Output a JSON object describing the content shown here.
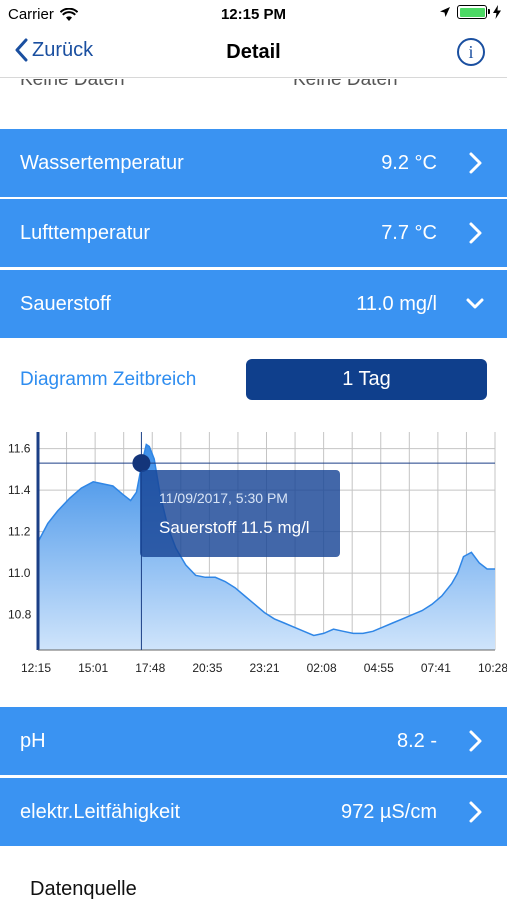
{
  "status_bar": {
    "carrier": "Carrier",
    "time": "12:15 PM"
  },
  "nav": {
    "back_label": "Zurück",
    "title": "Detail",
    "info_glyph": "i"
  },
  "cut_row": {
    "left": "Keine Daten",
    "right": "Keine Daten"
  },
  "rows": [
    {
      "label": "Wassertemperatur",
      "value": "9.2 °C",
      "icon": "chevron-right-icon"
    },
    {
      "label": "Lufttemperatur",
      "value": "7.7 °C",
      "icon": "chevron-right-icon"
    },
    {
      "label": "Sauerstoff",
      "value": "11.0 mg/l",
      "icon": "chevron-down-icon"
    },
    {
      "label": "pH",
      "value": "8.2 -",
      "icon": "chevron-right-icon"
    },
    {
      "label": "elektr.Leitfähigkeit",
      "value": "972 µS/cm",
      "icon": "chevron-right-icon"
    }
  ],
  "range": {
    "label": "Diagramm Zeitbreich",
    "button": "1 Tag"
  },
  "tooltip": {
    "date": "11/09/2017, 5:30 PM",
    "value": "Sauerstoff 11.5 mg/l"
  },
  "source_label": "Datenquelle",
  "colors": {
    "row_blue": "#3a93f2",
    "button_navy": "#0f3f8c",
    "link_blue": "#1a4fa0"
  },
  "chart_data": {
    "type": "area",
    "title": "",
    "xlabel": "",
    "ylabel": "",
    "ylim": [
      10.63,
      11.68
    ],
    "xlim_hours": [
      0,
      23.2
    ],
    "y_ticks": [
      "11.6",
      "11.4",
      "11.2",
      "11.0",
      "10.8"
    ],
    "x_ticks": [
      "12:15",
      "15:01",
      "17:48",
      "20:35",
      "23:21",
      "02:08",
      "04:55",
      "07:41",
      "10:28"
    ],
    "series": [
      {
        "x_hours": [
          0,
          0.5,
          1.0,
          1.6,
          2.2,
          2.8,
          3.3,
          3.8,
          4.3,
          4.7,
          5.0,
          5.3,
          5.5,
          5.65,
          5.9,
          6.2,
          6.6,
          7.0,
          7.5,
          8.0,
          8.5,
          9.0,
          9.5,
          10.0,
          10.5,
          11.0,
          11.5,
          12.0,
          12.5,
          13.0,
          13.5,
          14.0,
          14.5,
          15.0,
          15.5,
          16.0,
          16.5,
          17.0,
          17.5,
          18.0,
          18.5,
          19.0,
          19.5,
          20.0,
          20.5,
          21.0,
          21.3,
          21.6,
          22.0,
          22.4,
          22.8,
          23.2
        ],
        "values": [
          11.15,
          11.24,
          11.3,
          11.36,
          11.41,
          11.44,
          11.43,
          11.42,
          11.38,
          11.35,
          11.39,
          11.54,
          11.62,
          11.61,
          11.55,
          11.38,
          11.22,
          11.12,
          11.04,
          10.99,
          10.98,
          10.98,
          10.96,
          10.93,
          10.89,
          10.85,
          10.81,
          10.78,
          10.76,
          10.74,
          10.72,
          10.7,
          10.71,
          10.73,
          10.72,
          10.71,
          10.71,
          10.72,
          10.74,
          10.76,
          10.78,
          10.8,
          10.82,
          10.85,
          10.89,
          10.95,
          11.0,
          11.08,
          11.1,
          11.05,
          11.02,
          11.02
        ]
      }
    ],
    "highlight": {
      "x_hours": 5.25,
      "value": 11.53
    },
    "grid": true
  }
}
